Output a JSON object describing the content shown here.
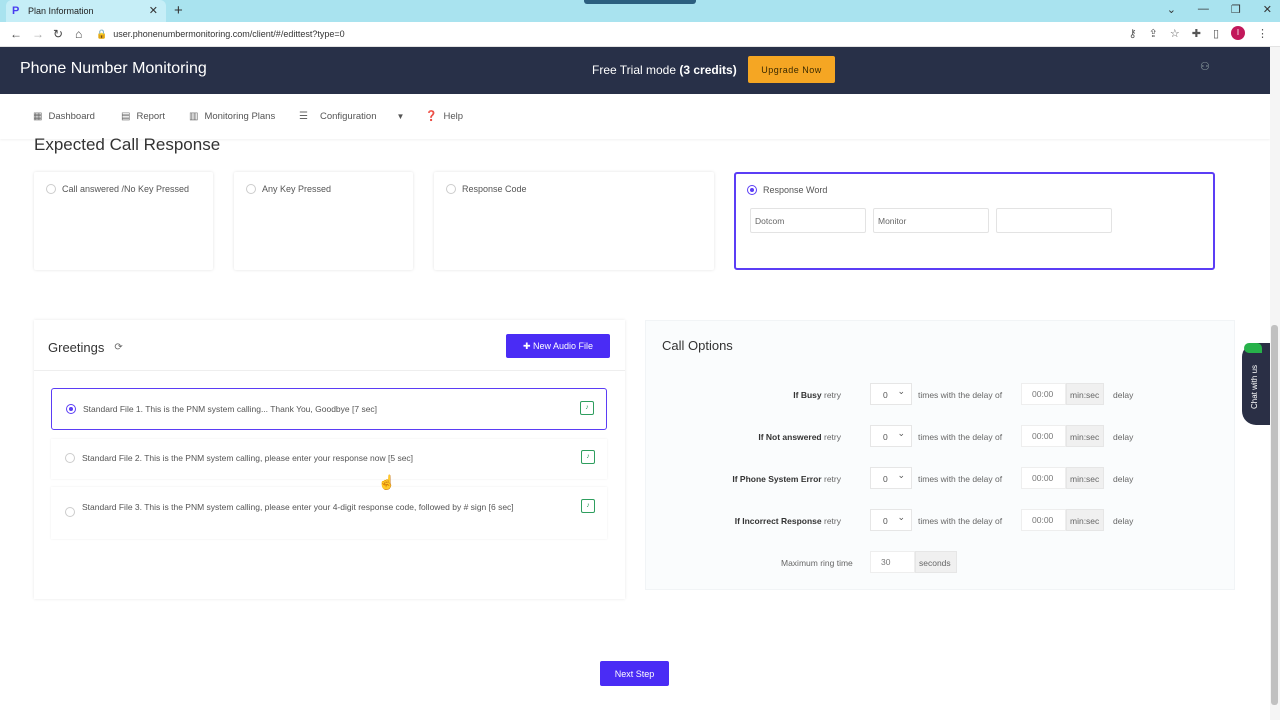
{
  "browser": {
    "tab_title": "Plan Information",
    "url": "user.phonenumbermonitoring.com/client/#/edittest?type=0"
  },
  "header": {
    "brand": "Phone Number Monitoring",
    "trial_prefix": "Free Trial mode ",
    "trial_credits": "(3 credits)",
    "upgrade_label": "Upgrade Now"
  },
  "nav": {
    "items": [
      {
        "label": "Dashboard",
        "icon": "dashboard-icon"
      },
      {
        "label": "Report",
        "icon": "report-icon"
      },
      {
        "label": "Monitoring Plans",
        "icon": "grid-icon"
      },
      {
        "label": "Configuration",
        "icon": "sliders-icon"
      },
      {
        "label": "Help",
        "icon": "help-icon"
      }
    ]
  },
  "expected": {
    "title": "Expected Call Response",
    "options": [
      {
        "label": "Call answered /No Key Pressed",
        "selected": false
      },
      {
        "label": "Any Key Pressed",
        "selected": false
      },
      {
        "label": "Response Code",
        "selected": false
      },
      {
        "label": "Response Word",
        "selected": true
      }
    ],
    "words": [
      "Dotcom",
      "Monitor",
      ""
    ]
  },
  "greetings": {
    "title": "Greetings",
    "new_audio_label": "New Audio File",
    "items": [
      {
        "text": "Standard File 1. This is the PNM system calling... Thank You, Goodbye [7 sec]",
        "selected": true
      },
      {
        "text": "Standard File 2. This is the PNM system calling, please enter your response now [5 sec]",
        "selected": false
      },
      {
        "text": "Standard File 3. This is the PNM system calling, please enter your 4-digit response code, followed by # sign [6 sec]",
        "selected": false
      }
    ]
  },
  "call_options": {
    "title": "Call Options",
    "rows": [
      {
        "bold": "If Busy",
        "retry": "retry",
        "count": "0",
        "mid": "times with the delay of",
        "time": "00:00",
        "unit": "min:sec",
        "tail": "delay"
      },
      {
        "bold": "If Not answered",
        "retry": "retry",
        "count": "0",
        "mid": "times with the delay of",
        "time": "00:00",
        "unit": "min:sec",
        "tail": "delay"
      },
      {
        "bold": "If Phone System Error",
        "retry": "retry",
        "count": "0",
        "mid": "times with the delay of",
        "time": "00:00",
        "unit": "min:sec",
        "tail": "delay"
      },
      {
        "bold": "If Incorrect Response",
        "retry": "retry",
        "count": "0",
        "mid": "times with the delay of",
        "time": "00:00",
        "unit": "min:sec",
        "tail": "delay"
      }
    ],
    "ring_label": "Maximum ring time",
    "ring_value": "30",
    "ring_unit": "seconds"
  },
  "next_step_label": "Next Step",
  "chat_label": "Chat with us"
}
